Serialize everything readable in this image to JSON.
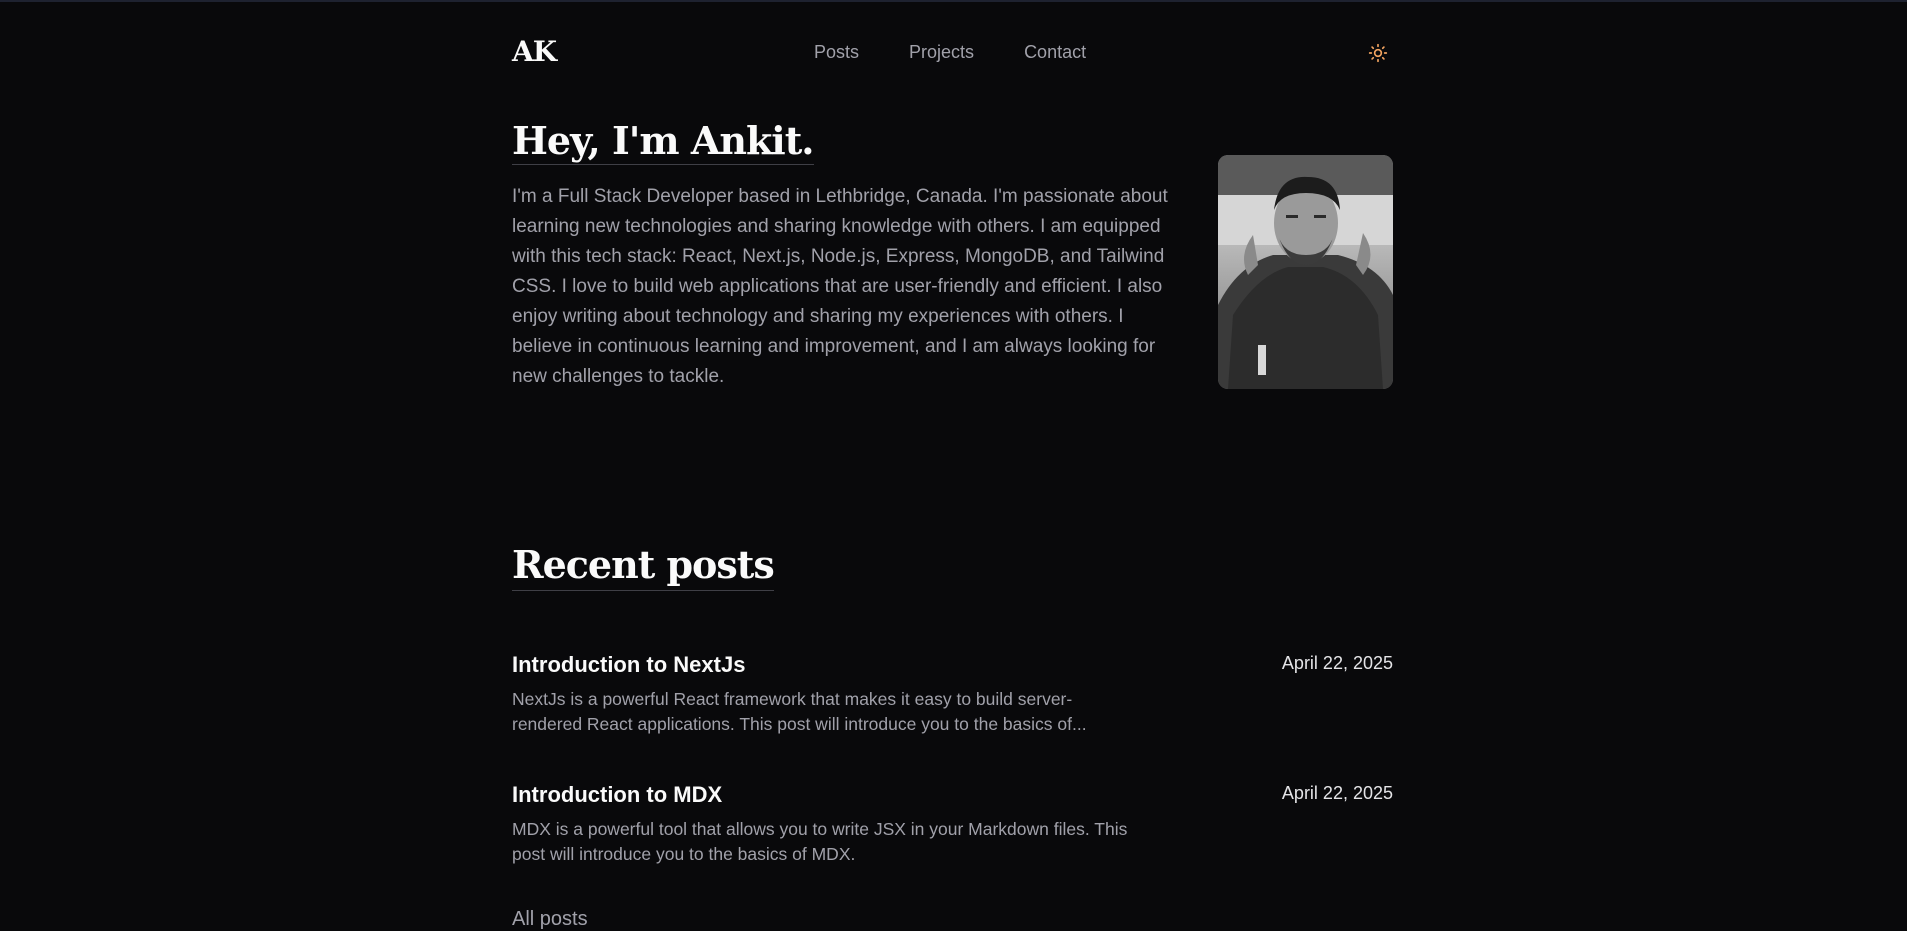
{
  "header": {
    "logo": "AK",
    "nav": [
      "Posts",
      "Projects",
      "Contact"
    ],
    "theme_icon": "sun-icon"
  },
  "hero": {
    "title": "Hey, I'm Ankit.",
    "bio": "I'm a Full Stack Developer based in Lethbridge, Canada. I'm passionate about learning new technologies and sharing knowledge with others. I am equipped with this tech stack: React, Next.js, Node.js, Express, MongoDB, and Tailwind CSS. I love to build web applications that are user-friendly and efficient. I also enjoy writing about technology and sharing my experiences with others. I believe in continuous learning and improvement, and I am always looking for new challenges to tackle."
  },
  "recent": {
    "title": "Recent posts",
    "posts": [
      {
        "title": "Introduction to NextJs",
        "date": "April 22, 2025",
        "summary": "NextJs is a powerful React framework that makes it easy to build server-rendered React applications. This post will introduce you to the basics of..."
      },
      {
        "title": "Introduction to MDX",
        "date": "April 22, 2025",
        "summary": "MDX is a powerful tool that allows you to write JSX in your Markdown files. This post will introduce you to the basics of MDX."
      }
    ],
    "all_posts_label": "All posts"
  },
  "colors": {
    "background": "#09090b",
    "sun_accent": "#f4a460"
  }
}
